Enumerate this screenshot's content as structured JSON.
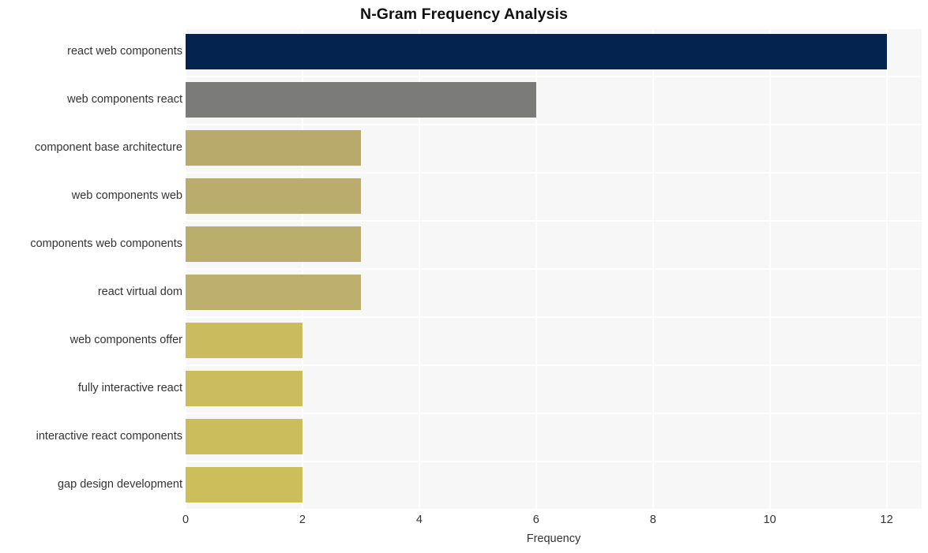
{
  "chart_data": {
    "type": "bar",
    "orientation": "horizontal",
    "title": "N-Gram Frequency Analysis",
    "xlabel": "Frequency",
    "ylabel": "",
    "categories": [
      "react web components",
      "web components react",
      "component base architecture",
      "web components web",
      "components web components",
      "react virtual dom",
      "web components offer",
      "fully interactive react",
      "interactive react components",
      "gap design development"
    ],
    "values": [
      12,
      6,
      3,
      3,
      3,
      3,
      2,
      2,
      2,
      2
    ],
    "bar_colors": [
      "#04234f",
      "#7b7b79",
      "#b7aa6a",
      "#b9ac6c",
      "#bbae6d",
      "#bdb06f",
      "#cabb5e",
      "#cbbc5d",
      "#ccbd5c",
      "#cdbe5c"
    ],
    "xlim": [
      0,
      12.6
    ],
    "xticks": [
      0,
      2,
      4,
      6,
      8,
      10,
      12
    ],
    "xtick_labels": [
      "0",
      "2",
      "4",
      "6",
      "8",
      "10",
      "12"
    ],
    "grid": true,
    "grid_color": "#ffffff",
    "plot_background": "#f7f7f7",
    "figure_background": "#ffffff",
    "legend": null,
    "title_color": "#111111",
    "tick_label_color": "#333333"
  }
}
